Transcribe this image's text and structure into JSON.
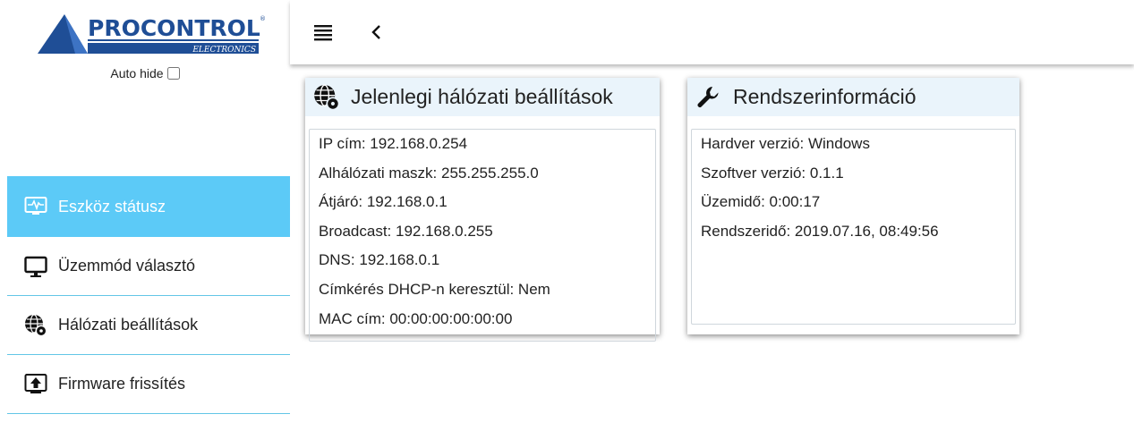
{
  "logo": {
    "brand": "PROCONTROL",
    "sub": "ELECTRONICS",
    "mark": "®"
  },
  "autohide": {
    "label": "Auto hide",
    "checked": false
  },
  "nav": {
    "items": [
      {
        "label": "Eszköz státusz",
        "icon": "monitor-pulse-icon",
        "active": true
      },
      {
        "label": "Üzemmód választó",
        "icon": "monitor-icon",
        "active": false
      },
      {
        "label": "Hálózati beállítások",
        "icon": "globe-gear-icon",
        "active": false
      },
      {
        "label": "Firmware frissítés",
        "icon": "upload-icon",
        "active": false
      }
    ]
  },
  "topbar": {
    "menu_icon": "hamburger-icon",
    "back_icon": "chevron-left-icon"
  },
  "network_card": {
    "title": "Jelenlegi hálózati beállítások",
    "rows": [
      "IP cím: 192.168.0.254",
      "Alhálózati maszk: 255.255.255.0",
      "Átjáró: 192.168.0.1",
      "Broadcast: 192.168.0.255",
      "DNS: 192.168.0.1",
      "Címkérés DHCP-n keresztül: Nem",
      "MAC cím: 00:00:00:00:00:00"
    ]
  },
  "system_card": {
    "title": "Rendszerinformáció",
    "rows": [
      "Hardver verzió: Windows",
      "Szoftver verzió: 0.1.1",
      "Üzemidő: 0:00:17",
      "Rendszeridő: 2019.07.16, 08:49:56"
    ]
  },
  "colors": {
    "accent": "#5ccaf7",
    "brand": "#1f4e96",
    "divider": "#63c6e6",
    "card_header": "#eaf4fb"
  }
}
